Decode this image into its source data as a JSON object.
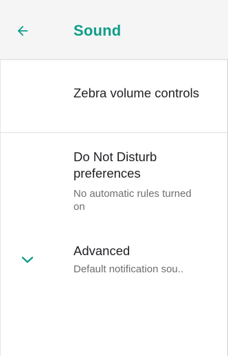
{
  "header": {
    "title": "Sound",
    "back_icon": "arrow-back-icon",
    "accent_color": "#0f9d89"
  },
  "preferences": [
    {
      "title": "Zebra volume controls",
      "summary": ""
    },
    {
      "title": "Do Not Disturb preferences",
      "summary": "No automatic rules turned on"
    },
    {
      "title": "Advanced",
      "summary": "Default notification sou..",
      "icon": "chevron-down-icon"
    }
  ]
}
